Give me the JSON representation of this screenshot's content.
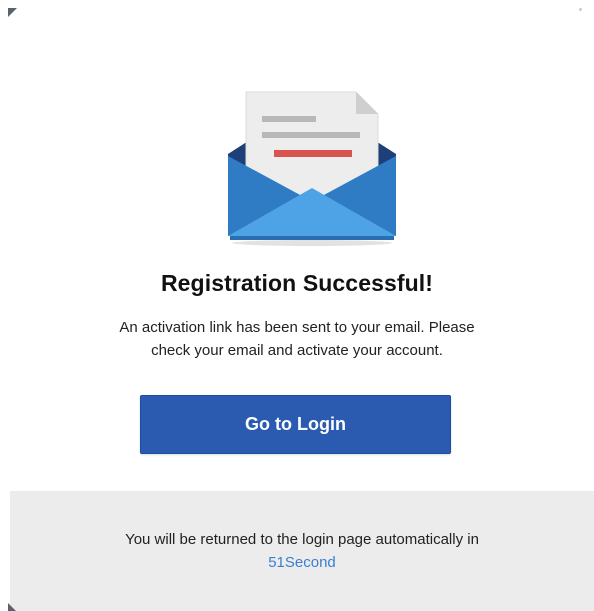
{
  "dialog": {
    "title": "Registration Successful!",
    "message_line1": "An activation link has been sent to your email. Please",
    "message_line2": "check your email and activate your account.",
    "icon": "envelope-icon"
  },
  "login_button": {
    "label": "Go to Login",
    "color": "#2a5bb0"
  },
  "footer": {
    "text": "You will be returned to the login page automatically in",
    "countdown": "51Second",
    "countdown_color": "#3a7fd0",
    "background": "#ececec"
  }
}
